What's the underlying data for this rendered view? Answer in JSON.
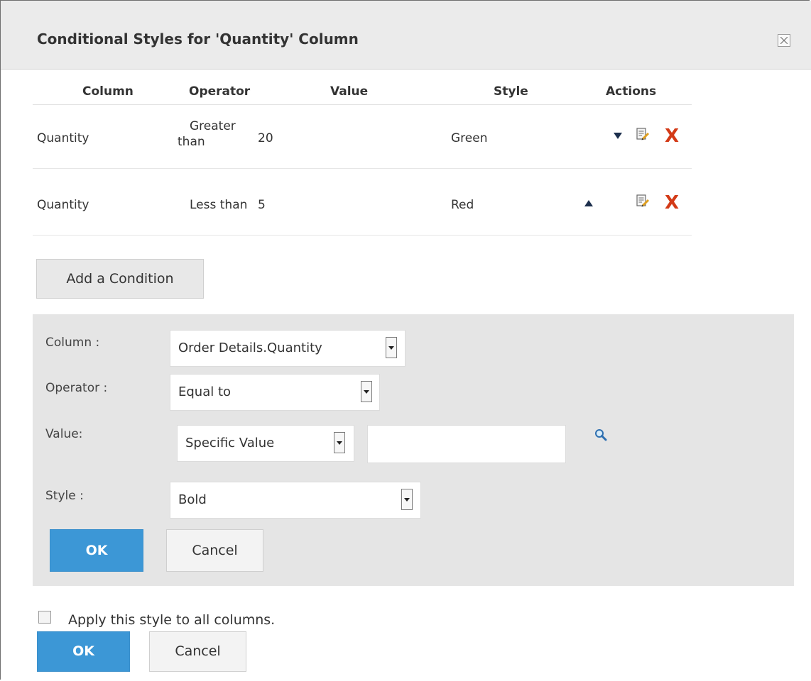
{
  "dialog": {
    "title": "Conditional Styles for 'Quantity' Column"
  },
  "table": {
    "headers": {
      "column": "Column",
      "operator": "Operator",
      "value": "Value",
      "style": "Style",
      "actions": "Actions"
    },
    "rows": [
      {
        "column": "Quantity",
        "operator_line1": "Greater",
        "operator_line2": "than",
        "value": "20",
        "style": "Green"
      },
      {
        "column": "Quantity",
        "operator": "Less than",
        "value": "5",
        "style": "Red"
      }
    ]
  },
  "add_condition_label": "Add a Condition",
  "editor": {
    "column_label": "Column :",
    "column_value": "Order Details.Quantity",
    "operator_label": "Operator :",
    "operator_value": "Equal to",
    "value_label": "Value:",
    "value_type": "Specific Value",
    "value_input": "",
    "style_label": "Style :",
    "style_value": "Bold",
    "ok_label": "OK",
    "cancel_label": "Cancel"
  },
  "apply_all_label": "Apply this style to all columns.",
  "footer": {
    "ok_label": "OK",
    "cancel_label": "Cancel"
  },
  "colors": {
    "primary_button": "#3c97d6",
    "delete_icon": "#d33a17",
    "editor_bg": "#e5e5e5",
    "titlebar_bg": "#ebebeb"
  }
}
